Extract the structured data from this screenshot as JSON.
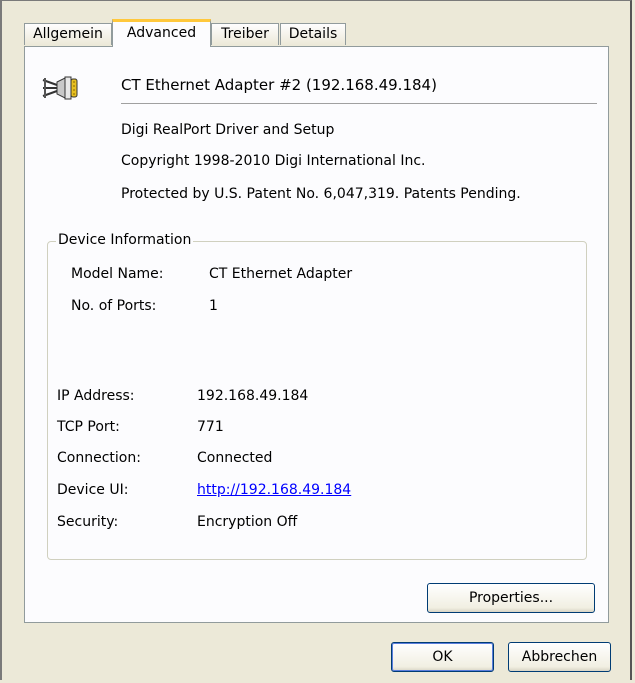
{
  "tabs": [
    {
      "label": "Allgemein"
    },
    {
      "label": "Advanced"
    },
    {
      "label": "Treiber"
    },
    {
      "label": "Details"
    }
  ],
  "device": {
    "icon": "network-adapter-icon",
    "title": "CT Ethernet Adapter #2 (192.168.49.184)",
    "driver": "Digi RealPort Driver and Setup",
    "copyright": "Copyright 1998-2010 Digi International Inc.",
    "patent": "Protected by U.S. Patent No. 6,047,319. Patents Pending."
  },
  "info": {
    "group_title": "Device Information",
    "model_label": "Model Name:",
    "model_value": "CT Ethernet Adapter",
    "ports_label": "No. of Ports:",
    "ports_value": "1",
    "ip_label": "IP Address:",
    "ip_value": "192.168.49.184",
    "tcp_label": "TCP Port:",
    "tcp_value": "771",
    "connection_label": "Connection:",
    "connection_value": "Connected",
    "ui_label": "Device UI:",
    "ui_value": "http://192.168.49.184",
    "security_label": "Security:",
    "security_value": "Encryption Off"
  },
  "buttons": {
    "properties": "Properties...",
    "ok": "OK",
    "cancel": "Abbrechen"
  },
  "colors": {
    "dialog_bg": "#ece9d8",
    "panel_bg": "#fcfcfe",
    "active_tab_accent": "#ffc83c",
    "link": "#0000ff"
  }
}
